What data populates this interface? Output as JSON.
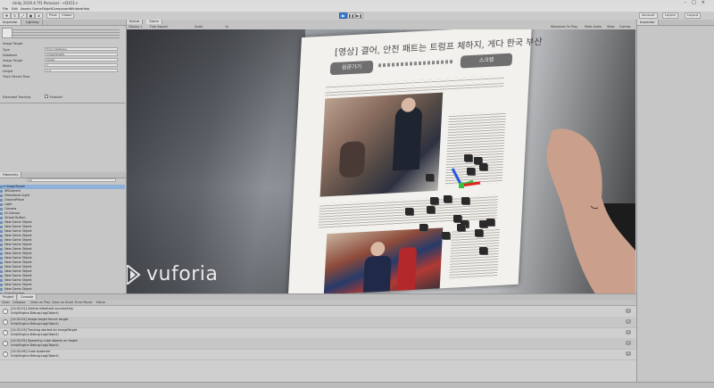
{
  "window": {
    "title": "Unity 2019.4.7f1 Personal - <DX11>",
    "controls": [
      "–",
      "□",
      "×"
    ]
  },
  "menu": [
    "File",
    "Edit",
    "Assets",
    "GameObject",
    "Component",
    "Window",
    "Help"
  ],
  "toolbar": {
    "tools": [
      "✥",
      "↻",
      "⤢",
      "▣",
      "⊕"
    ],
    "pivot": "Pivot",
    "global": "Global",
    "play": "▶",
    "pause": "❚❚",
    "step": "▶❚",
    "account": "Account",
    "layers": "Layers",
    "layout": "Layout"
  },
  "inspector_left": {
    "tabs": [
      "Inspector",
      "Lighting"
    ],
    "rows": [
      {
        "label": "Image Target",
        "value": ""
      },
      {
        "label": "Type",
        "value": "From Database"
      },
      {
        "label": "Database",
        "value": "ImageTargets"
      },
      {
        "label": "Image Target",
        "value": "target"
      },
      {
        "label": "Width",
        "value": "1"
      },
      {
        "label": "Height",
        "value": "1.4"
      },
      {
        "label": "Track Device Pose",
        "value": ""
      },
      {
        "label": "Extended Tracking",
        "value": ""
      }
    ],
    "checkbox_label": "Enabled"
  },
  "hierarchy": {
    "tab": "Hierarchy",
    "search": "All",
    "items": [
      "▾ ImageTarget",
      "  ARCamera",
      "  Directional Light",
      "  GroundPlane",
      "  Light",
      "  Camera",
      "  UI Canvas",
      "  Virtual Button",
      "  New Game Object",
      "  New Game Object",
      "  New Game Object",
      "  New Game Object",
      "  New Game Object",
      "  New Game Object",
      "  New Game Object",
      "  New Game Object",
      "  New Game Object",
      "  New Game Object",
      "  New Game Object",
      "  New Game Object",
      "  New Game Object",
      "  New Game Object",
      "  New Game Object",
      "  New Game Object",
      "  EventSystem"
    ]
  },
  "game_view": {
    "tabs": [
      "Scene",
      "Game"
    ],
    "display": "Display 1",
    "aspect": "Free Aspect",
    "scale_label": "Scale",
    "scale_value": "1x",
    "options": [
      "Maximize On Play",
      "Mute Audio",
      "Stats",
      "Gizmos"
    ],
    "watermark": "vuforia",
    "paper": {
      "headline": "[영상] 결어, 안전 패트는 트럼프 체하지, 게다 한국 부산",
      "button_left": "원문가기",
      "button_right": "스크랩"
    }
  },
  "inspector_right": {
    "tab": "Inspector"
  },
  "console": {
    "tabs": [
      "Project",
      "Console"
    ],
    "buttons": [
      "Clear",
      "Collapse",
      "Clear on Play",
      "Clear on Build",
      "Error Pause",
      "Editor"
    ],
    "logs": [
      {
        "time": "[14:32:01]",
        "line1": "Vuforia initialized successfully.",
        "line2": "UnityEngine.Debug:Log(Object)",
        "count": "1"
      },
      {
        "time": "[14:32:02]",
        "line1": "Image target found: target",
        "line2": "UnityEngine.Debug:Log(Object)",
        "count": "1"
      },
      {
        "time": "[14:32:03]",
        "line1": "Tracking started for ImageTarget",
        "line2": "UnityEngine.Debug:Log(Object)",
        "count": "1"
      },
      {
        "time": "[14:32:05]",
        "line1": "Spawning cube objects on target",
        "line2": "UnityEngine.Debug:Log(Object)",
        "count": "1"
      },
      {
        "time": "[14:32:06]",
        "line1": "Cube spawned",
        "line2": "UnityEngine.Debug:Log(Object)",
        "count": "1"
      }
    ]
  },
  "colors": {
    "play_active": "#3f7fd6",
    "selection": "#8fb0d9",
    "editor_bg": "#c8c8c8"
  }
}
